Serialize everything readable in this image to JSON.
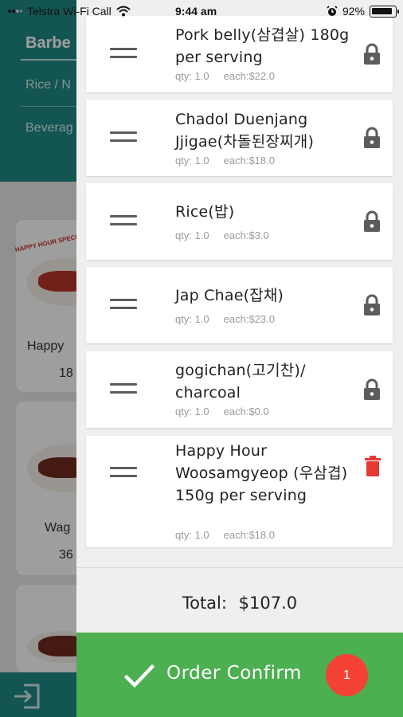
{
  "status_bar": {
    "carrier": "Telstra Wi-Fi Call",
    "time": "9:44 am",
    "battery": "92%",
    "battery_level": 0.92
  },
  "background": {
    "categories": [
      "Barbe",
      "Rice / N",
      "Beverag"
    ],
    "products": [
      {
        "name": "Happy",
        "price": "18",
        "badge": "HAPPY HOUR SPECIAL"
      },
      {
        "name": "Wag",
        "price": "36"
      }
    ]
  },
  "order": {
    "items": [
      {
        "name": "Pork belly(삼겹살) 180g per serving",
        "qty": "qty: 1.0",
        "each": "each:$22.0",
        "action_icon": "lock-icon"
      },
      {
        "name": "Chadol Duenjang Jjigae(차돌된장찌개)",
        "qty": "qty: 1.0",
        "each": "each:$18.0",
        "action_icon": "lock-icon"
      },
      {
        "name": "Rice(밥)",
        "qty": "qty: 1.0",
        "each": "each:$3.0",
        "action_icon": "lock-icon"
      },
      {
        "name": "Jap Chae(잡채)",
        "qty": "qty: 1.0",
        "each": "each:$23.0",
        "action_icon": "lock-icon"
      },
      {
        "name": "gogichan(고기찬)/ charcoal",
        "qty": "qty: 1.0",
        "each": "each:$0.0",
        "action_icon": "lock-icon"
      },
      {
        "name": "Happy Hour Woosamgyeop (우삼겹) 150g per serving",
        "qty": "qty: 1.0",
        "each": "each:$18.0",
        "action_icon": "trash-icon"
      }
    ],
    "total_label": "Total:",
    "total_value": "$107.0",
    "confirm_label": "Order Confirm",
    "confirm_count": "1"
  },
  "colors": {
    "teal_header": "#1f8a86",
    "confirm_green": "#4caf50",
    "badge_red": "#f44336",
    "trash_red": "#e53935",
    "lock_gray": "#5c5c5c"
  }
}
